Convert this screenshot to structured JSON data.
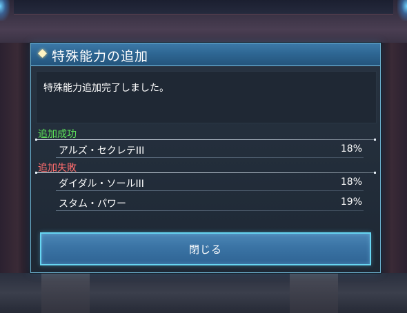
{
  "dialog": {
    "title": "特殊能力の追加",
    "message": "特殊能力追加完了しました。",
    "success": {
      "label": "追加成功",
      "items": [
        {
          "name": "アルズ・セクレテIII",
          "rate": "18%"
        }
      ]
    },
    "failure": {
      "label": "追加失敗",
      "items": [
        {
          "name": "ダイダル・ソールIII",
          "rate": "18%"
        },
        {
          "name": "スタム・パワー",
          "rate": "19%"
        }
      ]
    },
    "close_label": "閉じる"
  },
  "colors": {
    "accent_border": "#67d6f2",
    "title_bar": "#2d6591",
    "success_text": "#5ee35a",
    "failure_text": "#ff6d6d"
  },
  "icons": {
    "title_icon": "diamond-icon"
  }
}
